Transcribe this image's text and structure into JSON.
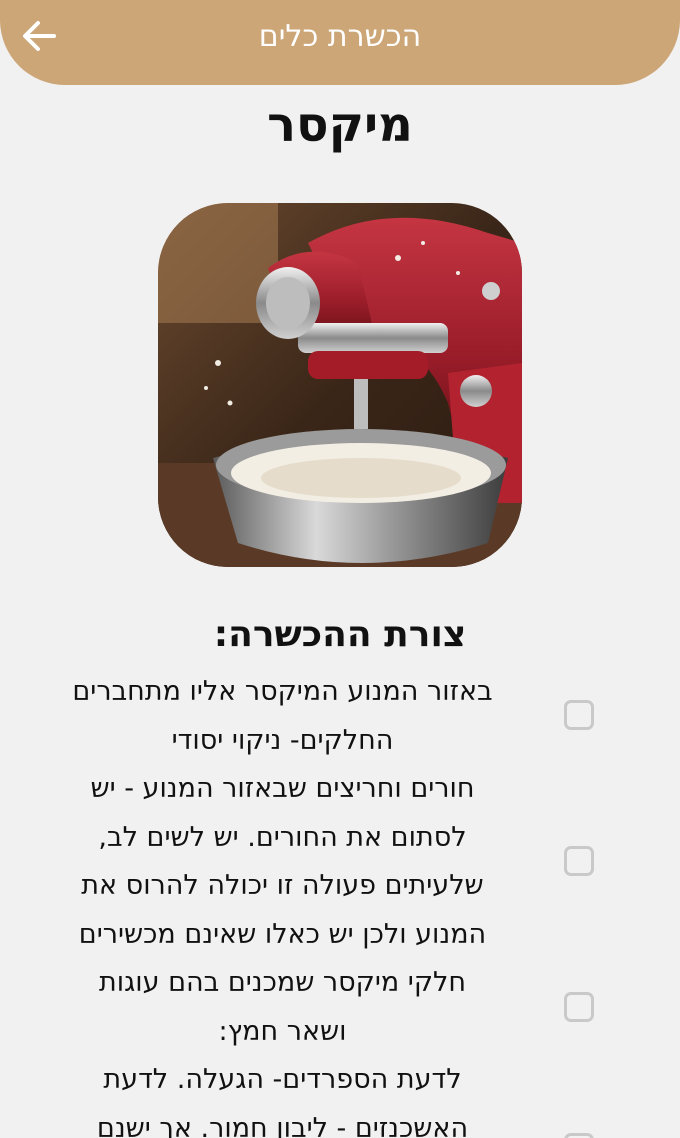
{
  "header": {
    "title": "הכשרת כלים",
    "back_icon": "arrow-left-icon",
    "background_color": "#cca677"
  },
  "page": {
    "title": "מיקסר"
  },
  "image": {
    "subject": "mixer"
  },
  "section": {
    "title": "צורת ההכשרה:"
  },
  "checklist": [
    {
      "text": "באזור המנוע המיקסר אליו מתחברים\nהחלקים- ניקוי יסודי",
      "checked": false
    },
    {
      "text": "חורים וחריצים שבאזור המנוע - יש\nלסתום את החורים. יש לשים לב,\nשלעיתים פעולה זו יכולה להרוס את\nהמנוע ולכן יש כאלו שאינם מכשירים",
      "checked": false
    },
    {
      "text": "חלקי מיקסר שמכנים בהם עוגות\nושאר חמץ:\nלדעת הספרדים- הגעלה. לדעת\nהאשכנזים - ליבון חמור. אך ישנם",
      "checked": false
    },
    {
      "text": "",
      "checked": false
    }
  ]
}
